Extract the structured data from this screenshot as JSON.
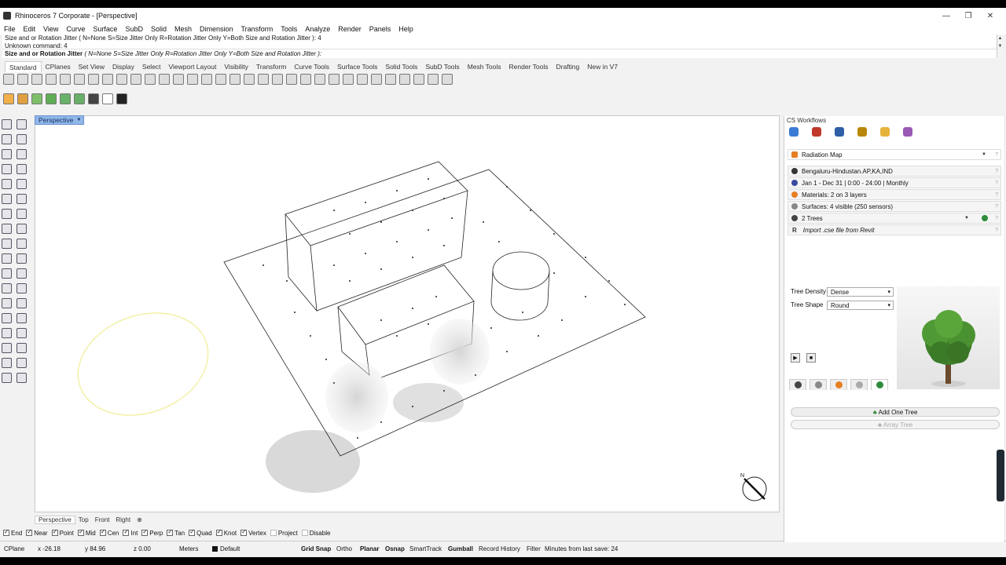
{
  "window": {
    "title": "Rhinoceros 7 Corporate - [Perspective]",
    "min": "—",
    "restore": "❐",
    "close": "✕"
  },
  "menu": [
    "File",
    "Edit",
    "View",
    "Curve",
    "Surface",
    "SubD",
    "Solid",
    "Mesh",
    "Dimension",
    "Transform",
    "Tools",
    "Analyze",
    "Render",
    "Panels",
    "Help"
  ],
  "command": {
    "history": [
      "Size and or Rotation Jitter ( N=None  S=Size Jitter Only  R=Rotation Jitter Only  Y=Both Size and Rotation Jitter ): 4",
      "Unknown command: 4"
    ],
    "prompt_label": "Size and or Rotation Jitter",
    "prompt_options": "( N=None  S=Size Jitter Only  R=Rotation Jitter Only  Y=Both Size and Rotation Jitter ):"
  },
  "toolbar_tabs": [
    "Standard",
    "CPlanes",
    "Set View",
    "Display",
    "Select",
    "Viewport Layout",
    "Visibility",
    "Transform",
    "Curve Tools",
    "Surface Tools",
    "Solid Tools",
    "SubD Tools",
    "Mesh Tools",
    "Render Tools",
    "Drafting",
    "New in V7"
  ],
  "viewport": {
    "label": "Perspective",
    "compass_label": "N"
  },
  "view_tabs": [
    "Perspective",
    "Top",
    "Front",
    "Right"
  ],
  "view_tab_add": "⊕",
  "osnaps": [
    {
      "label": "End",
      "on": true
    },
    {
      "label": "Near",
      "on": true
    },
    {
      "label": "Point",
      "on": true
    },
    {
      "label": "Mid",
      "on": true
    },
    {
      "label": "Cen",
      "on": true
    },
    {
      "label": "Int",
      "on": true
    },
    {
      "label": "Perp",
      "on": true
    },
    {
      "label": "Tan",
      "on": true
    },
    {
      "label": "Quad",
      "on": true
    },
    {
      "label": "Knot",
      "on": true
    },
    {
      "label": "Vertex",
      "on": true
    },
    {
      "label": "Project",
      "on": false
    },
    {
      "label": "Disable",
      "on": false
    }
  ],
  "status": {
    "cplane": "CPlane",
    "x": "x -26.18",
    "y": "y 84.96",
    "z": "z 0.00",
    "units": "Meters",
    "layer": "Default",
    "grid_snap": "Grid Snap",
    "ortho": "Ortho",
    "planar": "Planar",
    "osnap": "Osnap",
    "smarttrack": "SmartTrack",
    "gumball": "Gumball",
    "record_history": "Record History",
    "filter": "Filter",
    "save_msg": "Minutes from last save: 24"
  },
  "panel": {
    "title": "CS Workflows",
    "analysis": "Radiation Map",
    "location": "Bengaluru-Hindustan.AP,KA,IND",
    "period": "Jan 1 - Dec 31 | 0:00 - 24:00 | Monthly",
    "materials": "Materials: 2 on 3 layers",
    "surfaces": "Surfaces: 4 visible (250 sensors)",
    "trees": "2 Trees",
    "import": "Import .cse file from Revit",
    "tree_density_label": "Tree Density",
    "tree_density": "Dense",
    "tree_shape_label": "Tree Shape",
    "tree_shape": "Round",
    "add_one_tree": "Add One Tree",
    "array_tree": "Array Tree",
    "help": "?",
    "import_prefix": "R"
  },
  "colors": {
    "accent": "#8fb7e8",
    "tree_green": "#2e8b3a",
    "circle_yellow": "#f3f0a8"
  }
}
